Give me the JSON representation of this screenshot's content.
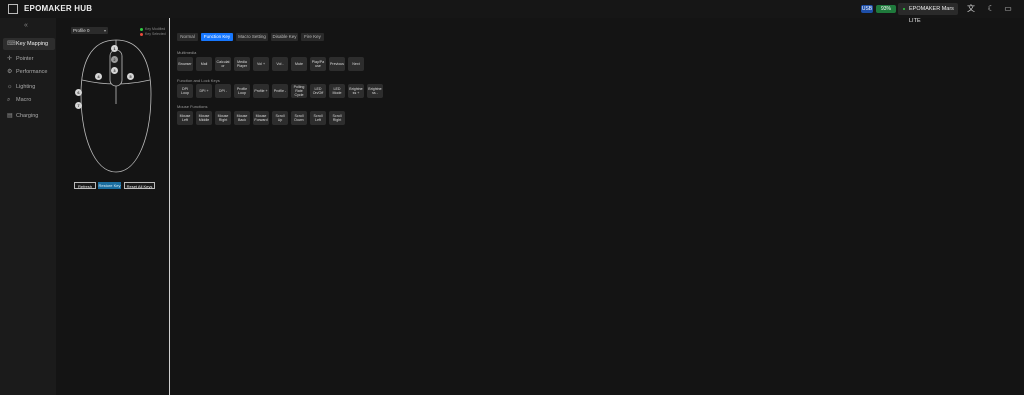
{
  "app": {
    "title": "EPOMAKER HUB",
    "link_badge": "USB",
    "battery_badge": "93%",
    "device_name": "EPOMAKER Mars LITE",
    "accent_color": "#1677ff"
  },
  "sidebar": {
    "collapse_icon": "double-chevron-left",
    "items": [
      {
        "label": "Key Mapping",
        "icon": "keyboard-icon",
        "glyph": "⌨"
      },
      {
        "label": "Pointer",
        "icon": "pointer-icon",
        "glyph": "✛"
      },
      {
        "label": "Performance",
        "icon": "performance-icon",
        "glyph": "⚙"
      },
      {
        "label": "Lighting",
        "icon": "lighting-icon",
        "glyph": "☼"
      },
      {
        "label": "Macro",
        "icon": "macro-icon",
        "glyph": "⌕"
      },
      {
        "label": "Charging",
        "icon": "battery-icon",
        "glyph": "▤"
      }
    ]
  },
  "mouse_panel": {
    "profile": "Profile 0",
    "legend": [
      {
        "label": "Key Modified",
        "color": "#2ecc40"
      },
      {
        "label": "Key Selected",
        "color": "#e74c3c"
      }
    ],
    "buttons": {
      "refresh": "Refresh",
      "restore": "Restore Key",
      "reset_all": "Reset All Keys"
    }
  },
  "tabs": [
    "Normal",
    "Function Key",
    "Macro Setting",
    "Disable Key",
    "Fire Key"
  ],
  "sections": [
    {
      "title": "Multimedia",
      "keys": [
        "Browser",
        "Mail",
        "Calculator",
        "Media Player",
        "Vol +",
        "Vol -",
        "Mute",
        "Play/Pause",
        "Previous",
        "Next"
      ]
    },
    {
      "title": "Function and Lock Keys",
      "keys": [
        "DPI Loop",
        "DPI +",
        "DPI -",
        "Profile Loop",
        "Profile +",
        "Profile -",
        "Polling Rate Cycle",
        "LED On/Off",
        "LED Mode",
        "Brightness +",
        "Brightness -"
      ]
    },
    {
      "title": "Mouse Functions",
      "keys": [
        "Mouse Left",
        "Mouse Middle",
        "Mouse Right",
        "Mouse Back",
        "Mouse Forward",
        "Scroll Up",
        "Scroll Down",
        "Scroll Left",
        "Scroll Right"
      ]
    }
  ]
}
